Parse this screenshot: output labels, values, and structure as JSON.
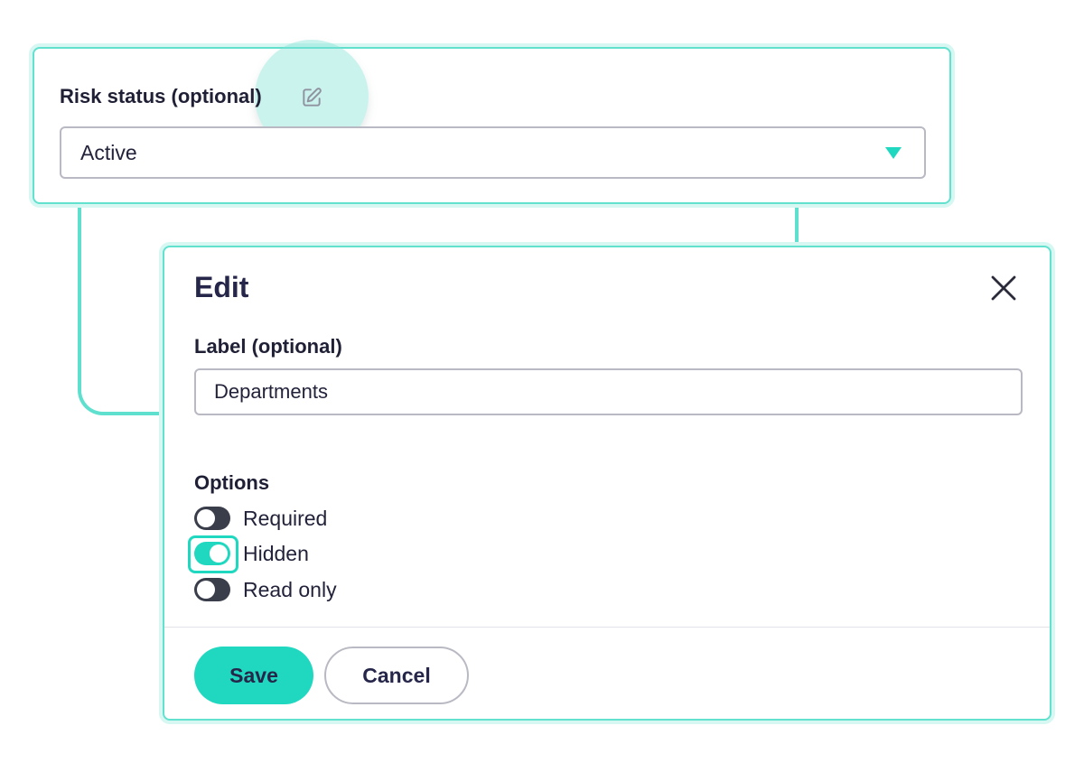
{
  "field_card": {
    "label": "Risk status (optional)",
    "select_value": "Active"
  },
  "edit_dialog": {
    "title": "Edit",
    "label_field": {
      "label": "Label (optional)",
      "value": "Departments"
    },
    "options_title": "Options",
    "options": [
      {
        "label": "Required",
        "enabled": false
      },
      {
        "label": "Hidden",
        "enabled": true
      },
      {
        "label": "Read only",
        "enabled": false
      }
    ],
    "save_label": "Save",
    "cancel_label": "Cancel"
  },
  "colors": {
    "accent": "#1fd8bf",
    "card_border": "#62e1cf",
    "text": "#22223a",
    "toggle_off": "#3a3d4a"
  },
  "icons": {
    "edit": "pencil-square-icon",
    "close": "close-icon",
    "caret": "caret-down-icon"
  }
}
